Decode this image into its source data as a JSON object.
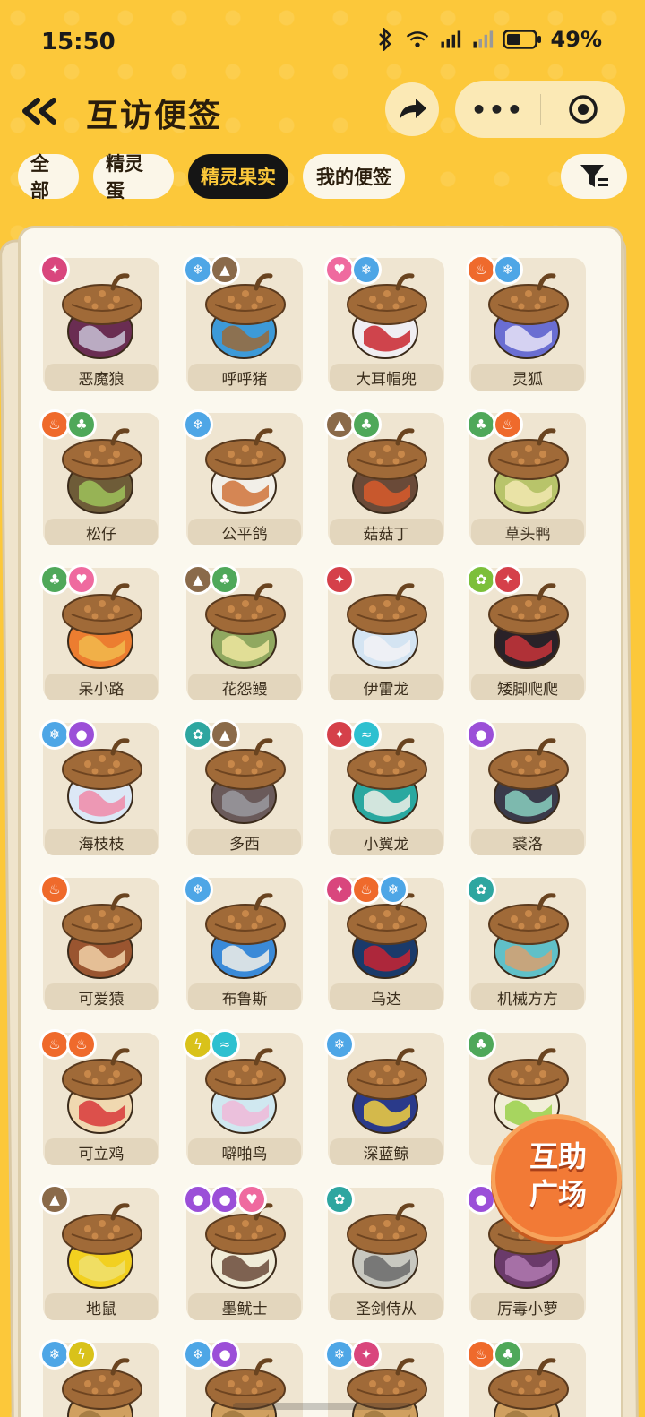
{
  "status": {
    "time": "15:50",
    "battery": "49%",
    "network": "4G"
  },
  "header": {
    "title": "互访便签",
    "back_icon": "double-chevron-left-icon",
    "share_icon": "share-arrow-icon",
    "more_label": "•••",
    "target_icon": "target-icon"
  },
  "tabs": [
    {
      "label": "全部",
      "active": false
    },
    {
      "label": "精灵蛋",
      "active": false
    },
    {
      "label": "精灵果实",
      "active": true
    },
    {
      "label": "我的便签",
      "active": false
    }
  ],
  "filter_icon": "filter-icon",
  "help_fab": {
    "line1": "互助",
    "line2": "广场"
  },
  "items": [
    {
      "name": "恶魔狼",
      "badges": [
        "pink"
      ],
      "colors": [
        "#6a2d52",
        "#c8c2d6"
      ]
    },
    {
      "name": "呼呼猪",
      "badges": [
        "blue",
        "brown"
      ],
      "colors": [
        "#3d9ad8",
        "#9a6a3a"
      ]
    },
    {
      "name": "大耳帽兜",
      "badges": [
        "lightpink",
        "blue"
      ],
      "colors": [
        "#f0eef2",
        "#c9262f"
      ]
    },
    {
      "name": "灵狐",
      "badges": [
        "orange",
        "blue"
      ],
      "colors": [
        "#6a6ed2",
        "#e8e4f8"
      ]
    },
    {
      "name": "松仔",
      "badges": [
        "orange",
        "green"
      ],
      "colors": [
        "#6e5c38",
        "#9fc25a"
      ]
    },
    {
      "name": "公平鸽",
      "badges": [
        "blue"
      ],
      "colors": [
        "#f2efe8",
        "#d0733a"
      ]
    },
    {
      "name": "菇菇丁",
      "badges": [
        "brown",
        "green"
      ],
      "colors": [
        "#6a4a38",
        "#d85a2c"
      ]
    },
    {
      "name": "草头鸭",
      "badges": [
        "green",
        "orange"
      ],
      "colors": [
        "#b8c46a",
        "#f2e9b0"
      ]
    },
    {
      "name": "呆小路",
      "badges": [
        "green",
        "lightpink"
      ],
      "colors": [
        "#ec7d30",
        "#f2b84c"
      ]
    },
    {
      "name": "花怨鳗",
      "badges": [
        "brown",
        "green"
      ],
      "colors": [
        "#90a860",
        "#f0e8a0"
      ]
    },
    {
      "name": "伊雷龙",
      "badges": [
        "red"
      ],
      "colors": [
        "#d4e4f2",
        "#f2f2f6"
      ]
    },
    {
      "name": "矮脚爬爬",
      "badges": [
        "lime",
        "red"
      ],
      "colors": [
        "#2a2228",
        "#c8343a"
      ]
    },
    {
      "name": "海枝枝",
      "badges": [
        "blue",
        "purple"
      ],
      "colors": [
        "#dce8f6",
        "#f08aa8"
      ]
    },
    {
      "name": "多西",
      "badges": [
        "teal",
        "brown"
      ],
      "colors": [
        "#6a5a5a",
        "#9a9aa0"
      ]
    },
    {
      "name": "小翼龙",
      "badges": [
        "red",
        "cyan"
      ],
      "colors": [
        "#2aa8a0",
        "#f0f0e8"
      ]
    },
    {
      "name": "裘洛",
      "badges": [
        "purple"
      ],
      "colors": [
        "#3a3a4a",
        "#8ad0c0"
      ]
    },
    {
      "name": "可爱猿",
      "badges": [
        "orange"
      ],
      "colors": [
        "#9a5530",
        "#f2d2a8"
      ]
    },
    {
      "name": "布鲁斯",
      "badges": [
        "blue"
      ],
      "colors": [
        "#3a8ad8",
        "#f2efe8"
      ]
    },
    {
      "name": "乌达",
      "badges": [
        "pink",
        "orange",
        "blue"
      ],
      "colors": [
        "#1a3a6a",
        "#c82432"
      ]
    },
    {
      "name": "机械方方",
      "badges": [
        "teal"
      ],
      "colors": [
        "#60c0c8",
        "#d8a070"
      ]
    },
    {
      "name": "可立鸡",
      "badges": [
        "orange",
        "orange"
      ],
      "colors": [
        "#f0d8b0",
        "#d8383a"
      ]
    },
    {
      "name": "噼啪鸟",
      "badges": [
        "yellow",
        "cyan"
      ],
      "colors": [
        "#d0e8f0",
        "#f0b8d8"
      ]
    },
    {
      "name": "深蓝鲸",
      "badges": [
        "blue"
      ],
      "colors": [
        "#2a3a8a",
        "#f2d040"
      ]
    },
    {
      "name": "",
      "badges": [
        "green"
      ],
      "colors": [
        "#f2eed8",
        "#9ad04a"
      ]
    },
    {
      "name": "地鼠",
      "badges": [
        "brown"
      ],
      "colors": [
        "#f2d020",
        "#f0e070"
      ]
    },
    {
      "name": "墨鱿士",
      "badges": [
        "purple",
        "purple",
        "lightpink"
      ],
      "colors": [
        "#f0ecd8",
        "#6a4a3a"
      ]
    },
    {
      "name": "圣剑侍从",
      "badges": [
        "teal"
      ],
      "colors": [
        "#c8c8c0",
        "#6a6a6a"
      ]
    },
    {
      "name": "厉毒小萝",
      "badges": [
        "purple"
      ],
      "colors": [
        "#6a3a6a",
        "#b07ab0"
      ]
    },
    {
      "name": "",
      "badges": [
        "blue",
        "yellow"
      ],
      "colors": [
        "#d0a060",
        "#a07840"
      ]
    },
    {
      "name": "",
      "badges": [
        "blue",
        "purple"
      ],
      "colors": [
        "#d0a060",
        "#a07840"
      ]
    },
    {
      "name": "",
      "badges": [
        "blue",
        "pink"
      ],
      "colors": [
        "#d0a060",
        "#a07840"
      ]
    },
    {
      "name": "",
      "badges": [
        "orange",
        "green"
      ],
      "colors": [
        "#d0a060",
        "#a07840"
      ]
    }
  ]
}
